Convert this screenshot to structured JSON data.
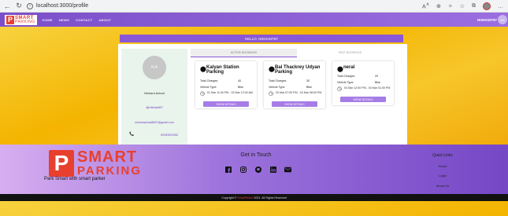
{
  "browser": {
    "url": "localhost:3000/profile",
    "back_icon": "back-arrow-icon",
    "refresh_icon": "refresh-icon"
  },
  "navbar": {
    "logo_letter": "P",
    "logo_smart": "SMART",
    "logo_parking": "PARKING",
    "links": [
      "HOME",
      "NEWS",
      "CONTACT",
      "ABOUT"
    ],
    "username": "NISHANT87",
    "avatar_initials": "NA",
    "color": "#8a57d6"
  },
  "greeting": "HELLO, NISHANT87",
  "profile": {
    "initials": "N A",
    "name": "Nishant Avhad",
    "username": "@nishant87",
    "email": "nishantavhad8697@gmail.com",
    "phone": "9292929292"
  },
  "tabs": {
    "active": "ACTIVE BOOKINGS",
    "past": "PAST BOOKINGS"
  },
  "labels": {
    "total_charges": "Total Charges:",
    "vehicle_type": "Vehicle Type:",
    "show_details": "SHOW DETAILS"
  },
  "bookings": [
    {
      "title": "Kalyan Station Parking",
      "charges": "40",
      "vehicle": "Bike",
      "time": "01 Mar 11:00 PM - 02 Mar 12:00 AM"
    },
    {
      "title": "Bal Thackrey Udyan Parking",
      "charges": "30",
      "vehicle": "Bike",
      "time": "03 Mar 07:00 PM - 03 Mar 08:00 PM"
    },
    {
      "title": "neral",
      "charges": "20",
      "vehicle": "Bike",
      "time": "04 Mar 12:00 PM - 04 Mar 01:00 PM"
    }
  ],
  "footer": {
    "logo_smart": "SMART",
    "logo_parking": "PARKING",
    "tagline": "Park Smart with smart parker",
    "get_in_touch": "Get in Touch",
    "social_icons": [
      "facebook-icon",
      "instagram-icon",
      "github-icon",
      "linkedin-icon",
      "mail-icon"
    ],
    "quick_links_title": "Quick Links",
    "quick_links": [
      "Home",
      "Login",
      "About Us"
    ]
  },
  "copyright": {
    "prefix": "Copyright ©",
    "brand": "SmartParker",
    "suffix": "2021. All Rights Reserved"
  }
}
